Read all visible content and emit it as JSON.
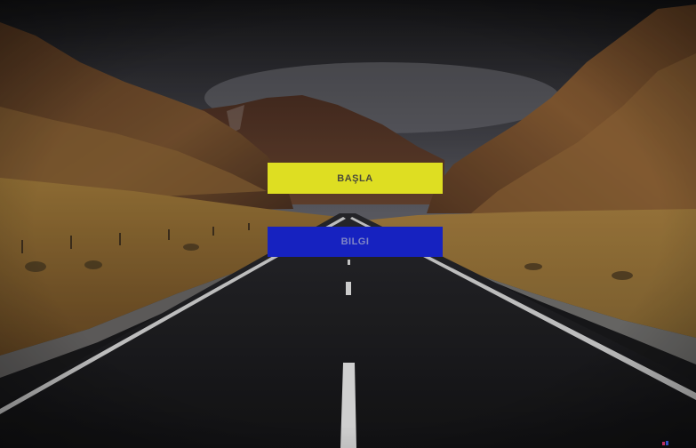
{
  "menu": {
    "start_label": "BAŞLA",
    "info_label": "BILGI"
  },
  "colors": {
    "start_button": "#dede22",
    "info_button": "#1622c0",
    "sky": "#2a2a30",
    "road": "#1c1c1f",
    "grass": "#8a6a30"
  },
  "background": {
    "icon": "mountain-road-background"
  }
}
